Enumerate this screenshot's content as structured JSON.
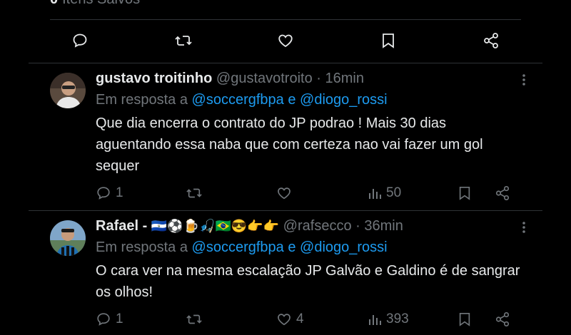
{
  "header_stat": {
    "count": "0",
    "label": "Itens Salvos"
  },
  "main_actions": {
    "reply": "reply",
    "retweet": "retweet",
    "like": "like",
    "bookmark": "bookmark",
    "share": "share"
  },
  "colors": {
    "background": "#000000",
    "text": "#e7e9ea",
    "muted": "#71767b",
    "link": "#1d9bf0",
    "divider": "#2f3336"
  },
  "tweets": [
    {
      "name": "gustavo troitinho",
      "handle": "@gustavotroito",
      "time": "· 16min",
      "reply_prefix": "Em resposta a",
      "mention1": "@soccergfbpa",
      "reply_and": "e",
      "mention2": "@diogo_rossi",
      "text": "Que dia encerra o contrato do JP podrao ! Mais 30 dias aguentando essa naba que com certeza nao vai fazer um gol sequer",
      "replies": "1",
      "retweets": "",
      "likes": "",
      "views": "50"
    },
    {
      "name": "Rafael -",
      "name_emojis": "🇸🇻⚽🍺🎣🇧🇷😎👉👉",
      "handle": "@rafsecco",
      "time": "· 36min",
      "reply_prefix": "Em resposta a",
      "mention1": "@soccergfbpa",
      "reply_and": "e",
      "mention2": "@diogo_rossi",
      "text": "O cara ver na mesma escalação JP Galvão e Galdino é de sangrar os olhos!",
      "replies": "1",
      "retweets": "",
      "likes": "4",
      "views": "393"
    }
  ]
}
